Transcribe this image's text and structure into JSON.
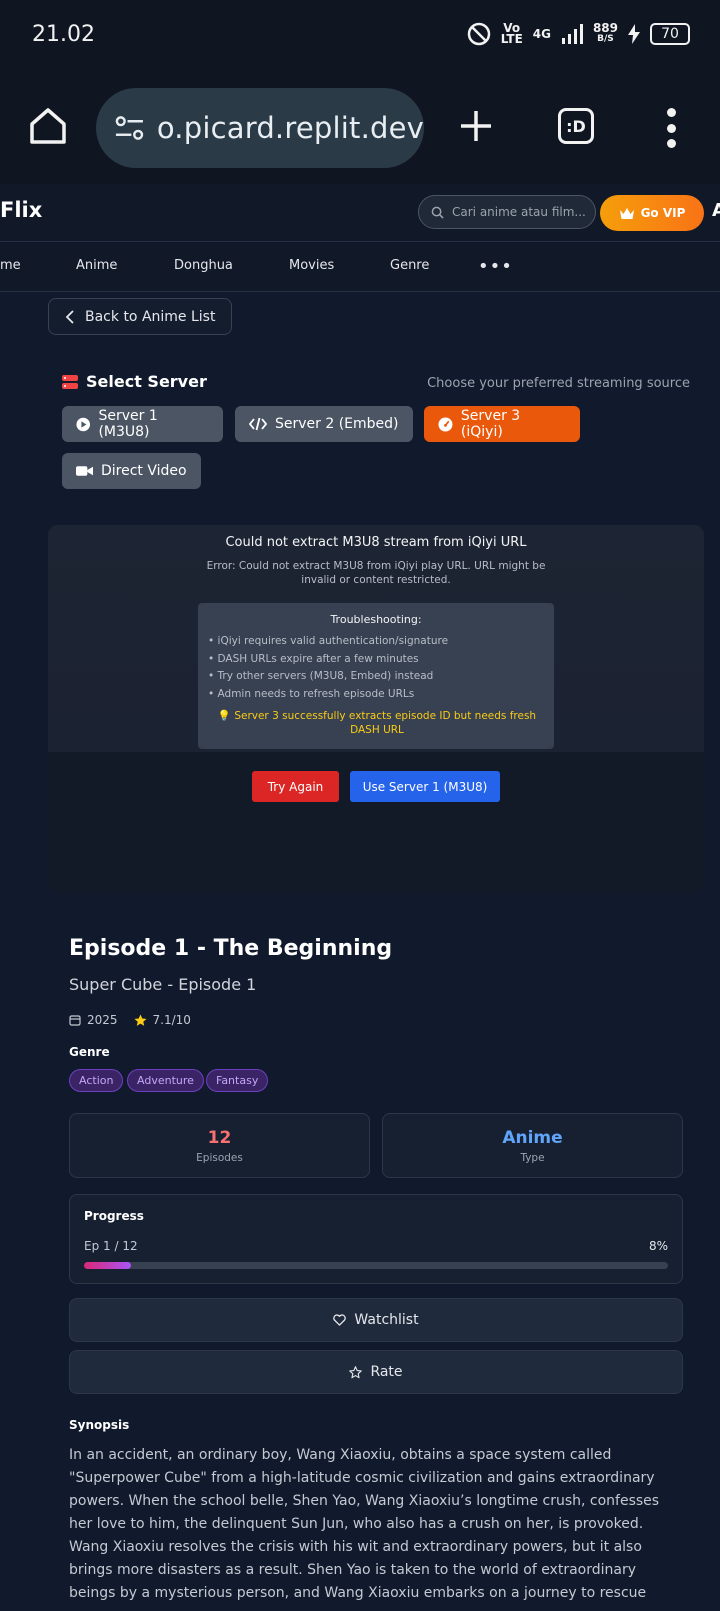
{
  "status": {
    "time": "21.02",
    "volte": "Vo LTE",
    "network": "4G",
    "speed_value": "889",
    "speed_unit": "B/S",
    "battery": "70"
  },
  "browser": {
    "url": "o.picard.replit.dev",
    "tab_label": ":D"
  },
  "header": {
    "brand": "Flix",
    "search_placeholder": "Cari anime atau film...",
    "vip_label": "Go VIP"
  },
  "nav": {
    "items": [
      "me",
      "Anime",
      "Donghua",
      "Movies",
      "Genre"
    ],
    "more": "•••"
  },
  "back_label": "Back to Anime List",
  "server": {
    "title": "Select Server",
    "hint": "Choose your preferred streaming source",
    "buttons": [
      "Server 1 (M3U8)",
      "Server 2 (Embed)",
      "Server 3 (iQiyi)",
      "Direct Video"
    ],
    "active_index": 2
  },
  "error": {
    "title": "Could not extract M3U8 stream from iQiyi URL",
    "message": "Error: Could not extract M3U8 from iQiyi play URL. URL might be invalid or content restricted.",
    "troubleshooting_title": "Troubleshooting:",
    "items": [
      "• iQiyi requires valid authentication/signature",
      "• DASH URLs expire after a few minutes",
      "• Try other servers (M3U8, Embed) instead",
      "• Admin needs to refresh episode URLs"
    ],
    "tip": "💡 Server 3 successfully extracts episode ID but needs fresh DASH URL",
    "try_again": "Try Again",
    "use_server1": "Use Server 1 (M3U8)"
  },
  "episode": {
    "title": "Episode 1 - The Beginning",
    "subtitle": "Super Cube - Episode 1",
    "year": "2025",
    "rating": "7.1/10",
    "genre_label": "Genre",
    "genres": [
      "Action",
      "Adventure",
      "Fantasy"
    ]
  },
  "stats": {
    "episodes_value": "12",
    "episodes_label": "Episodes",
    "type_value": "Anime",
    "type_label": "Type"
  },
  "progress": {
    "title": "Progress",
    "ep_text": "Ep 1 / 12",
    "percent_text": "8%",
    "percent": 8
  },
  "actions": {
    "watchlist": "Watchlist",
    "rate": "Rate"
  },
  "synopsis": {
    "title": "Synopsis",
    "text": "In an accident, an ordinary boy, Wang Xiaoxiu, obtains a space system called \"Superpower Cube\" from a high-latitude cosmic civilization and gains extraordinary powers. When the school belle, Shen Yao, Wang Xiaoxiu’s longtime crush, confesses her love to him, the delinquent Sun Jun, who also has a crush on her, is provoked. Wang Xiaoxiu resolves the crisis with his wit and extraordinary powers, but it also brings more disasters as a result. Shen Yao is taken to the world of extraordinary beings by a mysterious person, and Wang Xiaoxiu embarks on a journey to rescue"
  },
  "colors": {
    "accent_orange": "#ea580c",
    "episodes_color": "#f87171",
    "type_color": "#60a5fa",
    "vip_gold": "#f59e0b"
  }
}
